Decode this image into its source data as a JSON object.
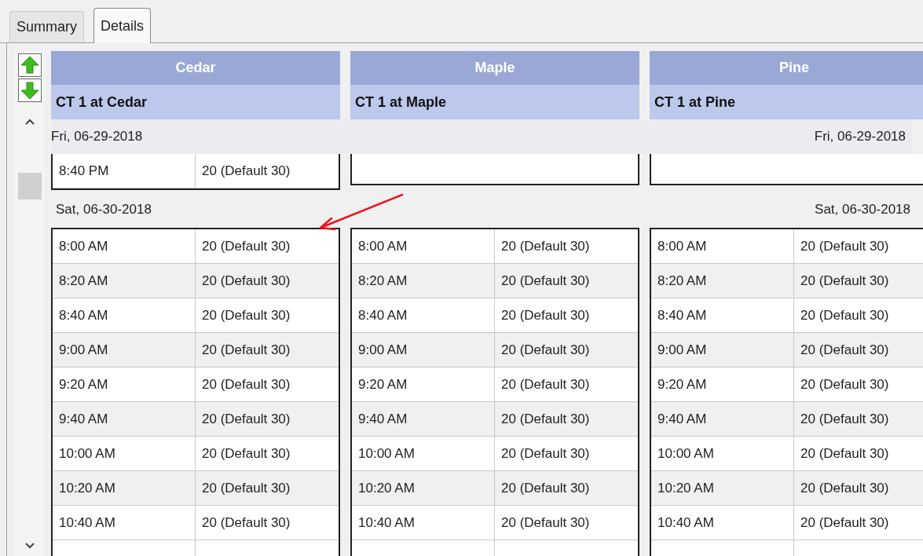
{
  "tabs": [
    {
      "label": "Summary",
      "selected": false
    },
    {
      "label": "Details",
      "selected": true
    }
  ],
  "columns": [
    {
      "name": "Cedar",
      "subtitle": "CT 1 at Cedar"
    },
    {
      "name": "Maple",
      "subtitle": "CT 1 at Maple"
    },
    {
      "name": "Pine",
      "subtitle": "CT 1 at Pine"
    }
  ],
  "days": [
    {
      "date_left": "Fri, 06-29-2018",
      "date_right": "Fri, 06-29-2018",
      "tables": [
        [
          {
            "time": "8:40 PM",
            "value": "20 (Default 30)"
          }
        ]
      ]
    },
    {
      "date_left": "Sat, 06-30-2018",
      "date_right": "Sat, 06-30-2018",
      "tables": [
        [
          {
            "time": "8:00 AM",
            "value": "20 (Default 30)"
          },
          {
            "time": "8:20 AM",
            "value": "20 (Default 30)"
          },
          {
            "time": "8:40 AM",
            "value": "20 (Default 30)"
          },
          {
            "time": "9:00 AM",
            "value": "20 (Default 30)"
          },
          {
            "time": "9:20 AM",
            "value": "20 (Default 30)"
          },
          {
            "time": "9:40 AM",
            "value": "20 (Default 30)"
          },
          {
            "time": "10:00 AM",
            "value": "20 (Default 30)"
          },
          {
            "time": "10:20 AM",
            "value": "20 (Default 30)"
          },
          {
            "time": "10:40 AM",
            "value": "20 (Default 30)"
          }
        ],
        [
          {
            "time": "8:00 AM",
            "value": "20 (Default 30)"
          },
          {
            "time": "8:20 AM",
            "value": "20 (Default 30)"
          },
          {
            "time": "8:40 AM",
            "value": "20 (Default 30)"
          },
          {
            "time": "9:00 AM",
            "value": "20 (Default 30)"
          },
          {
            "time": "9:20 AM",
            "value": "20 (Default 30)"
          },
          {
            "time": "9:40 AM",
            "value": "20 (Default 30)"
          },
          {
            "time": "10:00 AM",
            "value": "20 (Default 30)"
          },
          {
            "time": "10:20 AM",
            "value": "20 (Default 30)"
          },
          {
            "time": "10:40 AM",
            "value": "20 (Default 30)"
          }
        ],
        [
          {
            "time": "8:00 AM",
            "value": "20 (Default 30)"
          },
          {
            "time": "8:20 AM",
            "value": "20 (Default 30)"
          },
          {
            "time": "8:40 AM",
            "value": "20 (Default 30)"
          },
          {
            "time": "9:00 AM",
            "value": "20 (Default 30)"
          },
          {
            "time": "9:20 AM",
            "value": "20 (Default 30)"
          },
          {
            "time": "9:40 AM",
            "value": "20 (Default 30)"
          },
          {
            "time": "10:00 AM",
            "value": "20 (Default 30)"
          },
          {
            "time": "10:20 AM",
            "value": "20 (Default 30)"
          },
          {
            "time": "10:40 AM",
            "value": "20 (Default 30)"
          }
        ]
      ]
    }
  ]
}
